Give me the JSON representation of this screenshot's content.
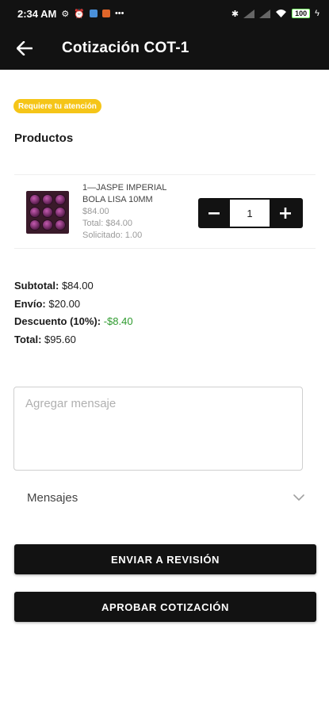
{
  "status_bar": {
    "time": "2:34 AM",
    "battery": "100"
  },
  "app_bar": {
    "title": "Cotización COT-1",
    "back_icon": "arrow-left-icon"
  },
  "badge": {
    "text": "Requiere tu atención",
    "color": "#f5c518"
  },
  "products_section": {
    "title": "Productos",
    "items": [
      {
        "name_line1": "1—JASPE IMPERIAL",
        "name_line2": "BOLA LISA 10MM",
        "price": "$84.00",
        "total": "Total: $84.00",
        "requested": "Solicitado: 1.00",
        "quantity": "1"
      }
    ]
  },
  "totals": {
    "subtotal_label": "Subtotal:",
    "subtotal_value": "$84.00",
    "shipping_label": "Envío:",
    "shipping_value": "$20.00",
    "discount_label": "Descuento (10%):",
    "discount_value": "-$8.40",
    "total_label": "Total:",
    "total_value": "$95.60",
    "discount_color": "#2e9b2e"
  },
  "message": {
    "placeholder": "Agregar mensaje",
    "value": ""
  },
  "messages_section": {
    "label": "Mensajes"
  },
  "actions": {
    "send_review_label": "ENVIAR A REVISIÓN",
    "approve_label": "APROBAR COTIZACIÓN"
  },
  "colors": {
    "header_bg": "#121212",
    "accent": "#f5c518",
    "button_bg": "#121212"
  }
}
